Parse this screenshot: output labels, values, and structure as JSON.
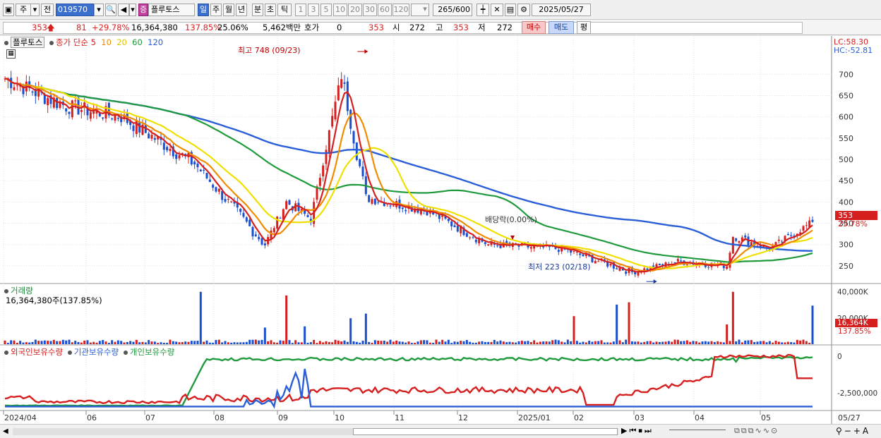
{
  "toolbar": {
    "period_main": "주",
    "prev_label": "전",
    "code": "019570",
    "stock_name": "플루토스",
    "stock_badge": "증",
    "periods": [
      "일",
      "주",
      "월",
      "년",
      "분",
      "초",
      "틱"
    ],
    "period_selected": "일",
    "intervals": [
      "1",
      "3",
      "5",
      "10",
      "20",
      "30",
      "60",
      "120"
    ],
    "count": "265",
    "count_total": "/600",
    "date": "2025/05/27"
  },
  "quote": {
    "price": "353",
    "change": "81",
    "change_pct": "+29.78%",
    "volume": "16,364,380",
    "volume_ratio": "137.85%",
    "turnover": "25.06%",
    "amount": "5,462백만",
    "hoga_label": "호가",
    "hoga_value": "0",
    "ask": "353",
    "open_label": "시",
    "open": "272",
    "high_label": "고",
    "high": "353",
    "low_label": "저",
    "low": "272",
    "buy_label": "매수",
    "sell_label": "매도",
    "eval_label": "평"
  },
  "price_panel": {
    "legend_name": "플루토스",
    "legend_type": "종가 단순",
    "ma_periods": [
      "5",
      "10",
      "20",
      "60",
      "120"
    ],
    "ma_colors": [
      "#d62020",
      "#f08c00",
      "#f0e000",
      "#1f9a3c",
      "#2b5fd8"
    ],
    "lc_label": "LC:58.30",
    "hc_label": "HC:-52.81",
    "last_price_tag": "353",
    "last_pct_tag": "29.78%",
    "high_annot": "최고 748 (09/23)",
    "low_annot": "최저 223 (02/18)",
    "dividend_annot": "배당락(0.00%)",
    "y_ticks": [
      "700",
      "650",
      "600",
      "550",
      "500",
      "450",
      "400",
      "350",
      "300",
      "250"
    ]
  },
  "volume_panel": {
    "title": "거래량",
    "value_text": "16,364,380주(137.85%)",
    "y_ticks": [
      "40,000K",
      "20,000K"
    ],
    "tag_value": "16,364K",
    "tag_pct": "137.85%"
  },
  "holding_panel": {
    "series": [
      "외국인보유수량",
      "기관보유수량",
      "개인보유수량"
    ],
    "colors": [
      "#d62020",
      "#2b5fd8",
      "#1f9a3c"
    ],
    "y_ticks": [
      "0",
      "-2,500,000"
    ]
  },
  "x_labels": [
    "2024/04",
    "06",
    "07",
    "08",
    "09",
    "10",
    "11",
    "12",
    "2025/01",
    "02",
    "03",
    "04",
    "05",
    "05/27"
  ],
  "chart_data": {
    "type": "candlestick",
    "title": "플루토스",
    "x_range": [
      "2024/04",
      "2025/05/27"
    ],
    "ylim": [
      220,
      760
    ],
    "price_points": [
      {
        "date": "2024/04",
        "close": 690
      },
      {
        "date": "2024/05",
        "close": 625
      },
      {
        "date": "2024/06",
        "close": 600
      },
      {
        "date": "2024/07",
        "close": 490
      },
      {
        "date": "2024/08",
        "close": 300
      },
      {
        "date": "2024/08-late",
        "close": 400
      },
      {
        "date": "2024/09",
        "close": 360
      },
      {
        "date": "2024/09/23",
        "close": 700,
        "high": 748
      },
      {
        "date": "2024/10",
        "close": 410
      },
      {
        "date": "2024/11",
        "close": 380
      },
      {
        "date": "2024/12",
        "close": 300
      },
      {
        "date": "2025/01",
        "close": 290
      },
      {
        "date": "2025/02/18",
        "close": 235,
        "low": 223
      },
      {
        "date": "2025/03",
        "close": 260
      },
      {
        "date": "2025/04",
        "close": 250
      },
      {
        "date": "2025/04-mid",
        "close": 320
      },
      {
        "date": "2025/05",
        "close": 290
      },
      {
        "date": "2025/05/27",
        "close": 353
      }
    ],
    "last_close": 353,
    "volume_last": 16364380
  }
}
